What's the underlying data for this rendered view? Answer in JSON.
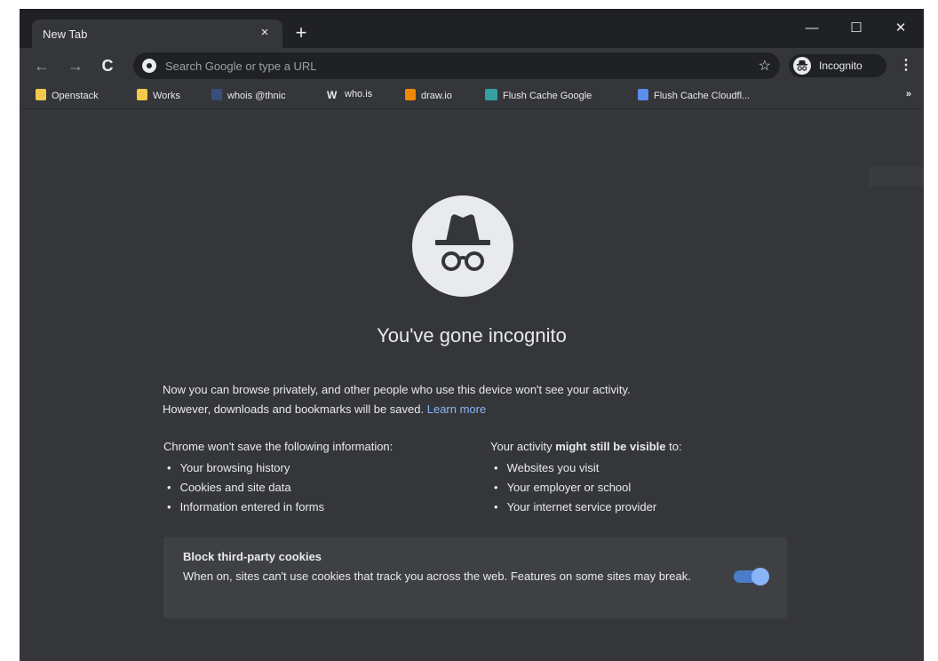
{
  "tab": {
    "title": "New Tab",
    "close": "×",
    "new_tab": "+"
  },
  "window": {
    "minimize": "—",
    "maximize": "☐",
    "close": "✕"
  },
  "toolbar": {
    "back": "←",
    "forward": "→",
    "reload": "C",
    "omnibox_placeholder": "Search Google or type a URL",
    "star": "☆",
    "profile_label": "Incognito",
    "menu": "⋮"
  },
  "bookmarks": {
    "items": [
      {
        "label": "Openstack",
        "icon": "folder-icon",
        "color": "#f2c94c"
      },
      {
        "label": "Works",
        "icon": "folder-icon",
        "color": "#f2c94c"
      },
      {
        "label": "whois @thnic",
        "icon": "th-icon",
        "color": "#3b5998"
      },
      {
        "label": "who.is",
        "icon": "w-icon",
        "color": "#e8eaed"
      },
      {
        "label": "draw.io",
        "icon": "drawio-icon",
        "color": "#f08705"
      },
      {
        "label": "Flush Cache Google",
        "icon": "dns-icon",
        "color": "#34a0a4"
      },
      {
        "label": "Flush Cache Cloudfl...",
        "icon": "cloudflare-icon",
        "color": "#5b8def"
      }
    ],
    "more": "»"
  },
  "page": {
    "heading": "You've gone incognito",
    "para_line1": "Now you can browse privately, and other people who use this device won't see your activity.",
    "para_line2": "However, downloads and bookmarks will be saved.",
    "learn_more": "Learn more",
    "left_title": "Chrome won't save the following information:",
    "left_items": [
      "Your browsing history",
      "Cookies and site data",
      "Information entered in forms"
    ],
    "right_title_pre": "Your activity ",
    "right_title_bold": "might still be visible",
    "right_title_post": " to:",
    "right_items": [
      "Websites you visit",
      "Your employer or school",
      "Your internet service provider"
    ],
    "cookie_title": "Block third-party cookies",
    "cookie_desc": "When on, sites can't use cookies that track you across the web. Features on some sites may break.",
    "cookie_toggle_on": true
  },
  "colors": {
    "accent": "#8ab4f8",
    "background": "#35363a",
    "tabstrip": "#202124"
  }
}
